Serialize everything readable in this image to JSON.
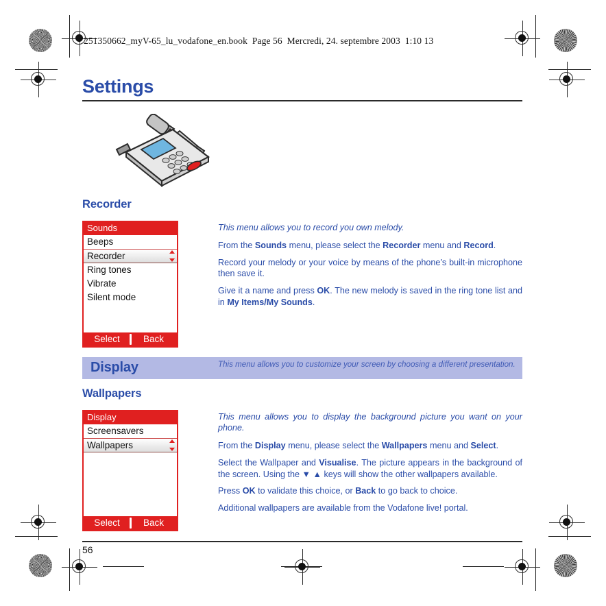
{
  "document": {
    "book_header": "251350662_myV-65_lu_vodafone_en.book  Page 56  Mercredi, 24. septembre 2003  1:10 13",
    "page_title": "Settings",
    "page_number": "56",
    "illustration_name": "phone-with-screwdriver-illustration"
  },
  "colors": {
    "heading_blue": "#2a4ca8",
    "body_blue": "#2a4ca8",
    "phone_red": "#e02020",
    "banner_lavender": "#b3b9e4",
    "rule_black": "#2a2a2a"
  },
  "recorder": {
    "heading": "Recorder",
    "screen": {
      "title": "Sounds",
      "items": [
        {
          "label": "Beeps",
          "selected": false
        },
        {
          "label": "Recorder",
          "selected": true
        },
        {
          "label": "Ring tones",
          "selected": false
        },
        {
          "label": "Vibrate",
          "selected": false
        },
        {
          "label": "Silent mode",
          "selected": false
        }
      ],
      "softkey_left": "Select",
      "softkey_right": "Back"
    },
    "intro": "This menu allows you to record you own melody.",
    "paragraphs": [
      {
        "parts": [
          {
            "t": "From the ",
            "b": false
          },
          {
            "t": "Sounds",
            "b": true
          },
          {
            "t": " menu, please select the ",
            "b": false
          },
          {
            "t": "Recorder",
            "b": true
          },
          {
            "t": " menu and ",
            "b": false
          },
          {
            "t": "Record",
            "b": true
          },
          {
            "t": ".",
            "b": false
          }
        ]
      },
      {
        "parts": [
          {
            "t": "Record your melody or your voice by means of the phone’s built-in microphone then save it.",
            "b": false
          }
        ]
      },
      {
        "parts": [
          {
            "t": "Give it a name and press ",
            "b": false
          },
          {
            "t": "OK",
            "b": true
          },
          {
            "t": ". The new melody is saved in the ring tone list and in ",
            "b": false
          },
          {
            "t": "My Items/My Sounds",
            "b": true
          },
          {
            "t": ".",
            "b": false
          }
        ]
      }
    ]
  },
  "display_banner": {
    "title": "Display",
    "text": "This menu allows you to customize your screen by choosing a different presentation."
  },
  "wallpapers": {
    "heading": "Wallpapers",
    "screen": {
      "title": "Display",
      "items": [
        {
          "label": "Screensavers",
          "selected": false
        },
        {
          "label": "Wallpapers",
          "selected": true
        }
      ],
      "softkey_left": "Select",
      "softkey_right": "Back"
    },
    "intro": "This menu allows you to display the background picture you want on your phone.",
    "paragraphs": [
      {
        "parts": [
          {
            "t": "From the ",
            "b": false
          },
          {
            "t": "Display",
            "b": true
          },
          {
            "t": " menu, please select the ",
            "b": false
          },
          {
            "t": "Wallpapers",
            "b": true
          },
          {
            "t": " menu and ",
            "b": false
          },
          {
            "t": "Select",
            "b": true
          },
          {
            "t": ".",
            "b": false
          }
        ]
      },
      {
        "parts": [
          {
            "t": "Select the Wallpaper and ",
            "b": false
          },
          {
            "t": "Visualise",
            "b": true
          },
          {
            "t": ". The picture appears in the background of the screen. Using the ",
            "b": false
          },
          {
            "t": "▼ ▲",
            "b": false
          },
          {
            "t": " keys will show the other wallpapers available.",
            "b": false
          }
        ]
      },
      {
        "parts": [
          {
            "t": "Press ",
            "b": false
          },
          {
            "t": "OK",
            "b": true
          },
          {
            "t": " to validate this choice, or ",
            "b": false
          },
          {
            "t": "Back",
            "b": true
          },
          {
            "t": " to go back to choice.",
            "b": false
          }
        ]
      },
      {
        "parts": [
          {
            "t": "Additional wallpapers are available from the Vodafone live! portal.",
            "b": false
          }
        ]
      }
    ]
  }
}
